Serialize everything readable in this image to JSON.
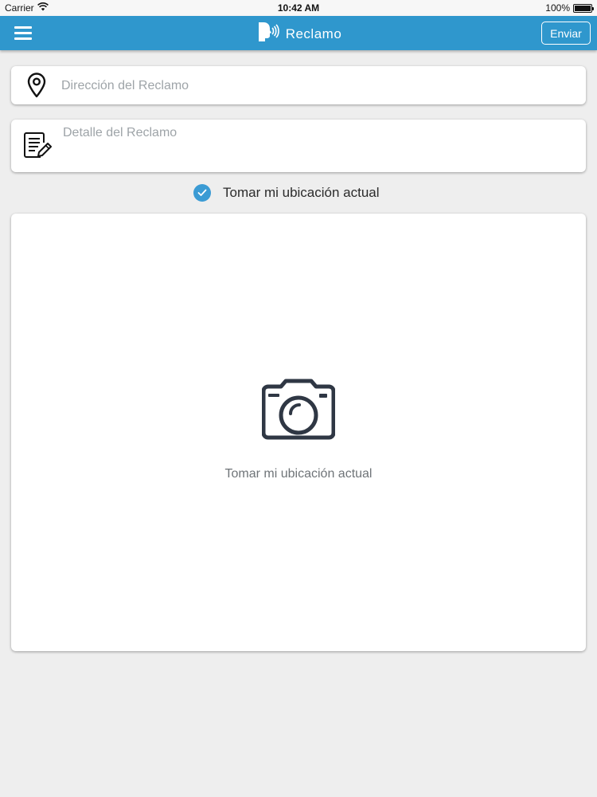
{
  "status_bar": {
    "carrier": "Carrier",
    "time": "10:42 AM",
    "battery": "100%",
    "wifi_icon": "wifi-icon",
    "battery_icon": "battery-icon"
  },
  "navbar": {
    "title": "Reclamo",
    "send_label": "Enviar",
    "menu_icon": "hamburger-menu-icon",
    "logo_icon": "speaking-head-icon",
    "background_color": "#2f97cd"
  },
  "form": {
    "address": {
      "placeholder": "Dirección del Reclamo",
      "value": "",
      "icon": "location-pin-icon"
    },
    "detail": {
      "placeholder": "Detalle del Reclamo",
      "value": "",
      "icon": "document-edit-icon"
    },
    "use_current_location": {
      "label": "Tomar mi ubicación actual",
      "checked": true,
      "icon": "checkmark-circle-icon",
      "color": "#3b9bd4"
    }
  },
  "photo": {
    "label": "Tomar mi ubicación actual",
    "icon": "camera-icon",
    "icon_color": "#2f3744"
  }
}
